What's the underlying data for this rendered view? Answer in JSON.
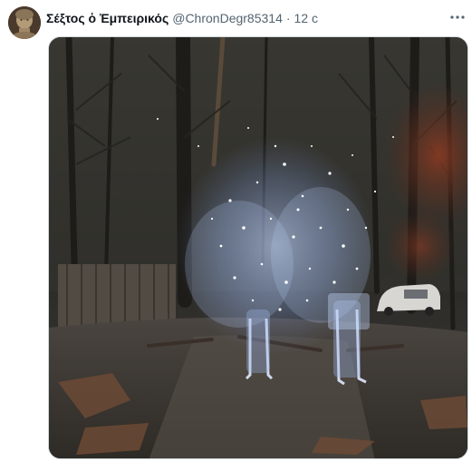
{
  "tweet": {
    "display_name": "Σέξτος ὁ Ἐμπειρικός",
    "handle": "@ChronDegr85314",
    "separator": "·",
    "time": "12 c",
    "more_icon": "more-horizontal-icon",
    "media": {
      "type": "video-still",
      "description_icon": "glowing-figures-forest-scene"
    }
  }
}
